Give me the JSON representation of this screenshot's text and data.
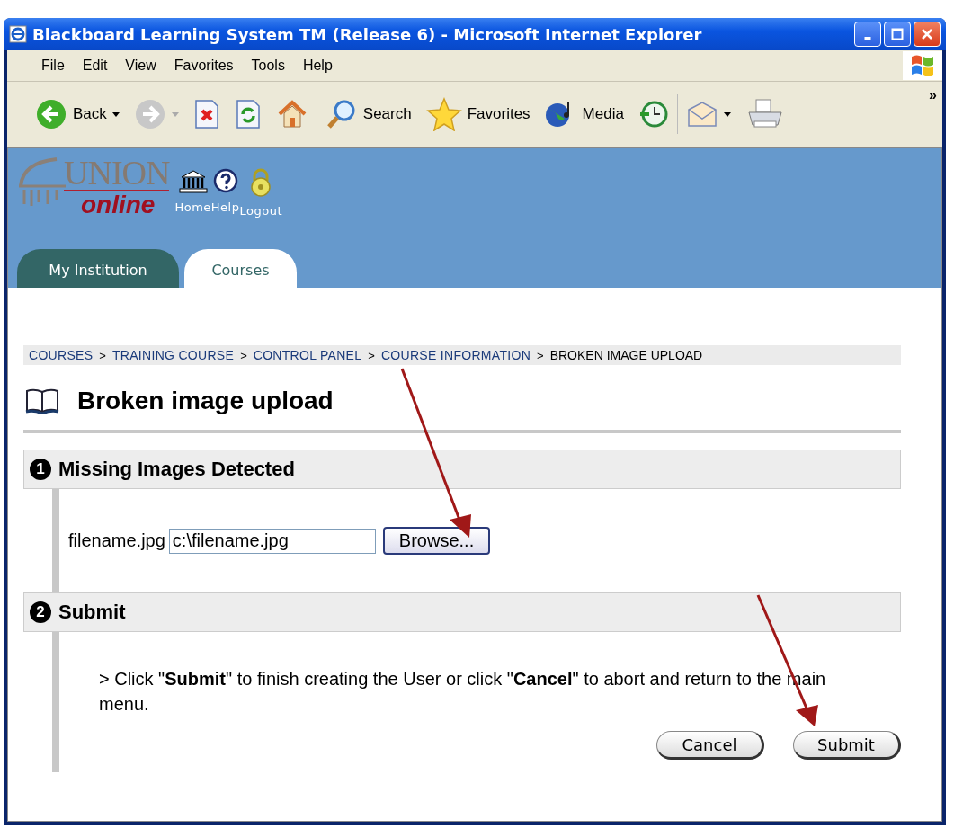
{
  "window": {
    "title": "Blackboard Learning System TM (Release 6) - Microsoft Internet Explorer"
  },
  "menu": [
    "File",
    "Edit",
    "View",
    "Favorites",
    "Tools",
    "Help"
  ],
  "toolbar": [
    {
      "kind": "back",
      "label": "Back",
      "dropdown": true
    },
    {
      "kind": "forward",
      "dropdown": true
    },
    {
      "kind": "stop"
    },
    {
      "kind": "refresh"
    },
    {
      "kind": "home"
    },
    {
      "kind": "search",
      "label": "Search"
    },
    {
      "kind": "favorites",
      "label": "Favorites"
    },
    {
      "kind": "media",
      "label": "Media"
    },
    {
      "kind": "history"
    },
    {
      "kind": "mail",
      "dropdown": true
    },
    {
      "kind": "print"
    }
  ],
  "toolbar_overflow": "»",
  "logo": {
    "title": "UNION",
    "subtitle": "online"
  },
  "header_links": [
    {
      "kind": "home",
      "label": "Home"
    },
    {
      "kind": "help",
      "label": "Help"
    },
    {
      "kind": "logout",
      "label": "Logout"
    }
  ],
  "tabs": [
    {
      "label": "My Institution",
      "selected": false
    },
    {
      "label": "Courses",
      "selected": true
    }
  ],
  "breadcrumb": [
    {
      "label": "COURSES",
      "link": true
    },
    {
      "label": "TRAINING COURSE",
      "link": true
    },
    {
      "label": "CONTROL PANEL",
      "link": true
    },
    {
      "label": "COURSE INFORMATION",
      "link": true
    },
    {
      "label": "BROKEN IMAGE UPLOAD",
      "link": false
    }
  ],
  "breadcrumb_separator": ">",
  "page_title": "Broken image upload",
  "sections": [
    {
      "number": "1",
      "title": "Missing Images Detected",
      "kind": "file",
      "label": "filename.jpg",
      "value": "c:\\filename.jpg",
      "button": "Browse..."
    },
    {
      "number": "2",
      "title": "Submit",
      "kind": "submit",
      "text": "> Click \"**Submit**\" to finish creating the User or click \"**Cancel**\" to abort and return to the main menu.",
      "buttons": [
        "Cancel",
        "Submit"
      ]
    }
  ]
}
